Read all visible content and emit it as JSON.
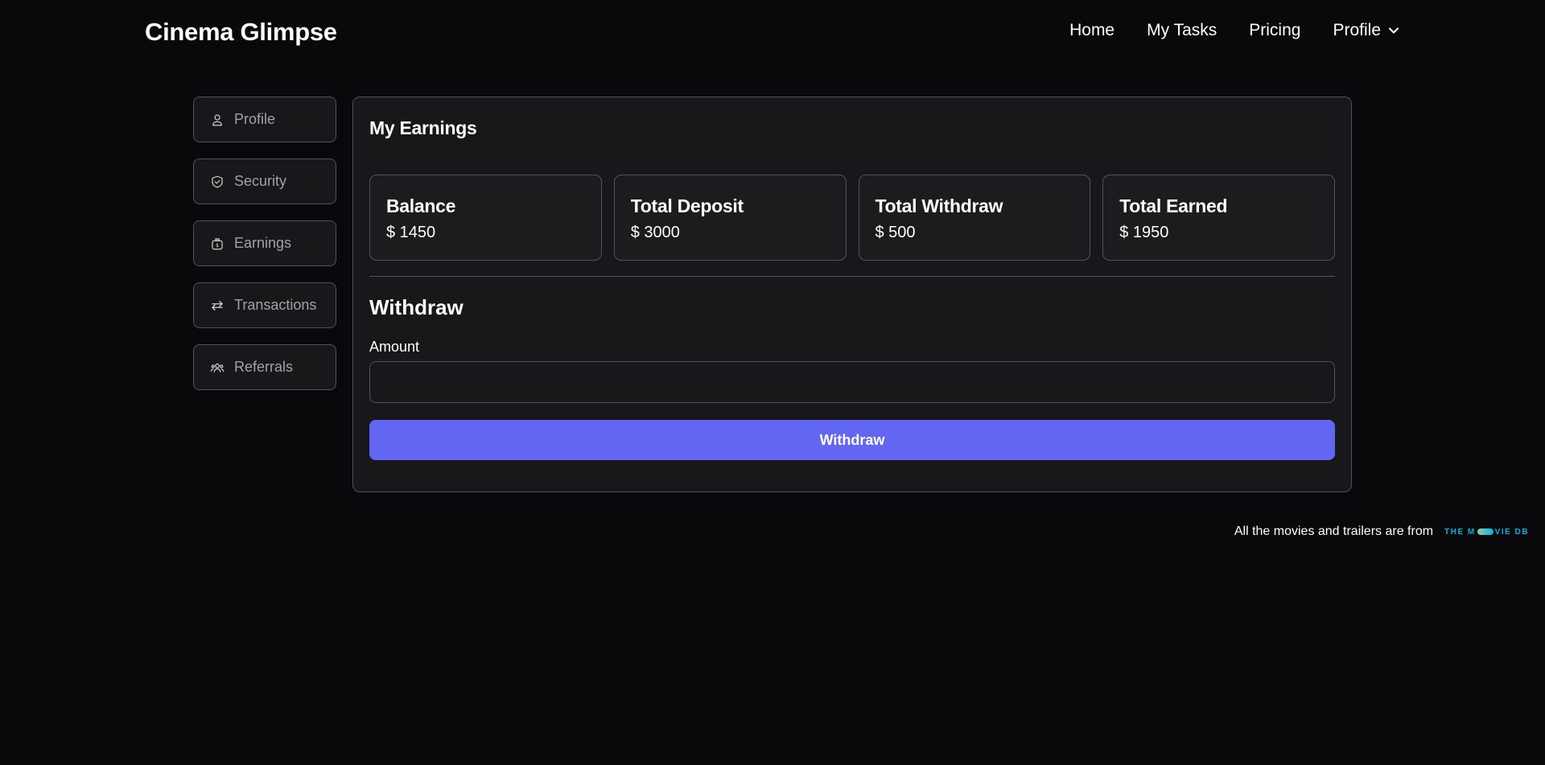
{
  "app": {
    "title": "Cinema Glimpse"
  },
  "nav": {
    "items": [
      {
        "label": "Home"
      },
      {
        "label": "My Tasks"
      },
      {
        "label": "Pricing"
      },
      {
        "label": "Profile"
      }
    ]
  },
  "sidebar": {
    "items": [
      {
        "label": "Profile",
        "icon": "user-icon"
      },
      {
        "label": "Security",
        "icon": "shield-icon"
      },
      {
        "label": "Earnings",
        "icon": "money-bag-icon"
      },
      {
        "label": "Transactions",
        "icon": "arrows-exchange-icon"
      },
      {
        "label": "Referrals",
        "icon": "users-icon"
      }
    ]
  },
  "main": {
    "title": "My Earnings",
    "stats": [
      {
        "label": "Balance",
        "value": "$ 1450"
      },
      {
        "label": "Total Deposit",
        "value": "$ 3000"
      },
      {
        "label": "Total Withdraw",
        "value": "$ 500"
      },
      {
        "label": "Total Earned",
        "value": "$ 1950"
      }
    ],
    "withdraw": {
      "title": "Withdraw",
      "amount_label": "Amount",
      "amount_value": "",
      "button_label": "Withdraw"
    }
  },
  "footer": {
    "text": "All the movies and trailers are from",
    "logo_text_left": "THE M",
    "logo_text_right": "VIE DB"
  },
  "colors": {
    "background": "#09090b",
    "panel": "#18181b",
    "border": "#52525b",
    "accent": "#6366f1",
    "tmdb": "#01b4e4"
  }
}
